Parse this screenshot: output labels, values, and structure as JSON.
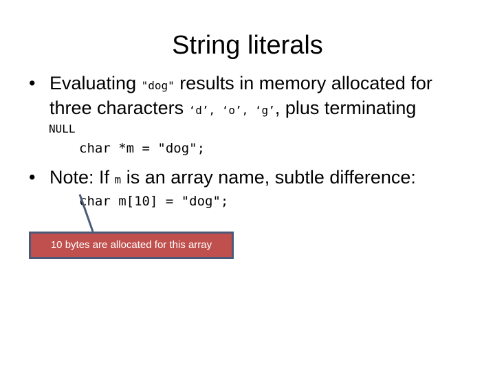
{
  "slide": {
    "title": "String literals",
    "bullet_glyph": "•",
    "bullet1": {
      "part1": "Evaluating ",
      "code1": "\"dog\"",
      "part2": " results in memory allocated for",
      "line2_part1": "three characters ",
      "code2": "‘d’, ‘o’, ‘g’",
      "line2_part2": ", plus terminating",
      "line3": "NULL"
    },
    "code_line1": "char *m = \"dog\";",
    "bullet2": {
      "part1": "Note: If ",
      "code": "m",
      "part2": " is an array name, subtle difference:"
    },
    "code_line2": "char m[10] = \"dog\";",
    "callout": {
      "text": "10 bytes are allocated for this array",
      "fill_color": "#c0504d",
      "border_color": "#4a5a78"
    }
  }
}
